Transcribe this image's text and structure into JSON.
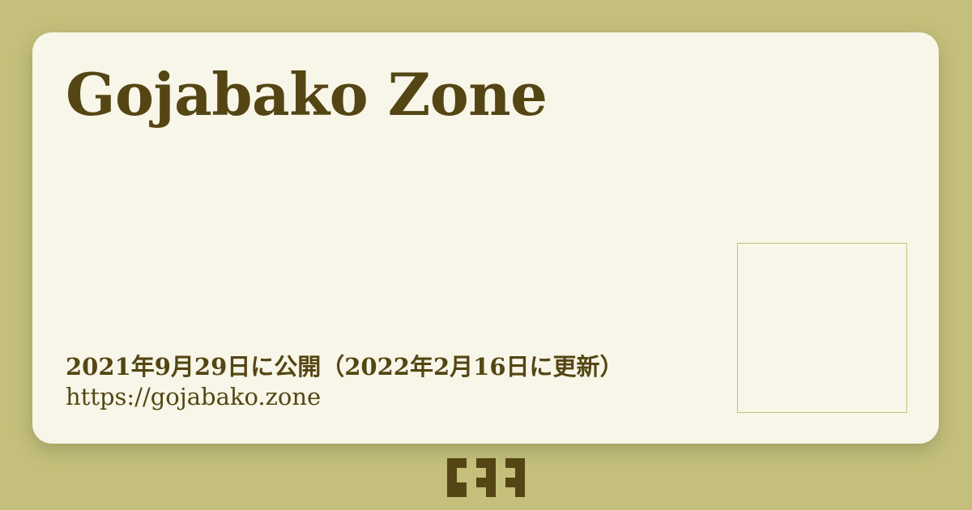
{
  "site": {
    "title": "Gojabako Zone",
    "dates": "2021年9月29日に公開（2022年2月16日に更新）",
    "url": "https://gojabako.zone"
  },
  "colors": {
    "background": "#c4c07b",
    "card": "#f8f6e8",
    "text": "#544614"
  },
  "icons": {
    "logo": "gojabako-logo-mark-icon",
    "image": "image-placeholder"
  }
}
